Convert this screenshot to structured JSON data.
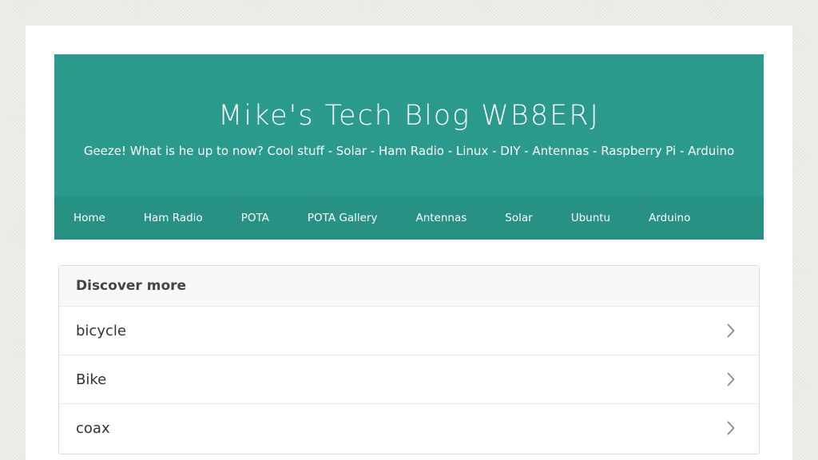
{
  "site": {
    "title": "Mike's Tech Blog WB8ERJ",
    "tagline": "Geeze! What is he up to now? Cool stuff - Solar - Ham Radio - Linux - DIY - Antennas - Raspberry Pi - Arduino",
    "colors": {
      "header": "#2a9a8c",
      "nav": "#279283",
      "background": "#ecebe4"
    }
  },
  "nav": {
    "items": [
      {
        "label": "Home"
      },
      {
        "label": "Ham Radio"
      },
      {
        "label": "POTA"
      },
      {
        "label": "POTA Gallery"
      },
      {
        "label": "Antennas"
      },
      {
        "label": "Solar"
      },
      {
        "label": "Ubuntu"
      },
      {
        "label": "Arduino"
      }
    ]
  },
  "discover": {
    "title": "Discover more",
    "items": [
      {
        "label": "bicycle",
        "icon": "chevron-right-icon"
      },
      {
        "label": "Bike",
        "icon": "chevron-right-icon"
      },
      {
        "label": "coax",
        "icon": "chevron-right-icon"
      }
    ]
  }
}
